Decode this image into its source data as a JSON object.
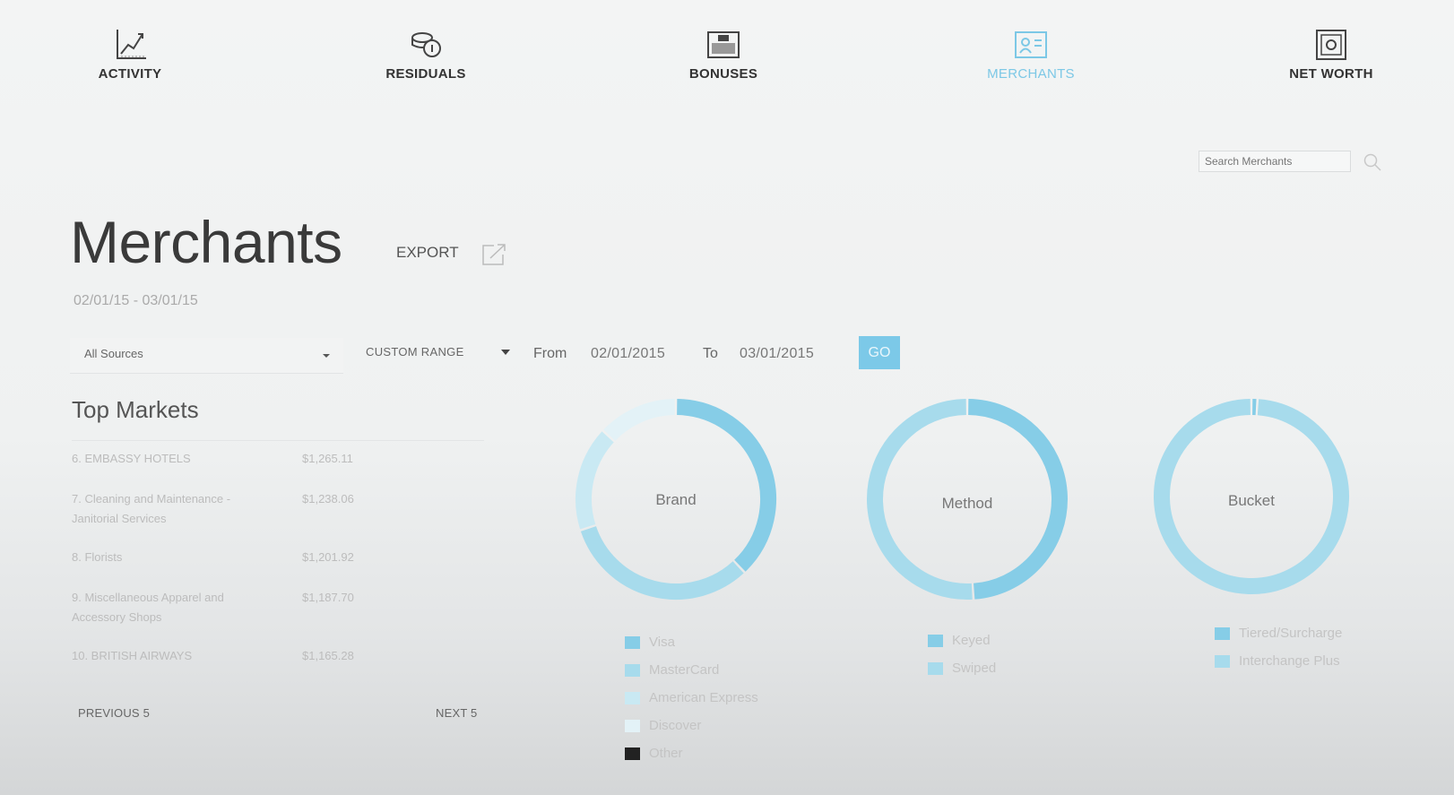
{
  "nav": [
    {
      "label": "ACTIVITY",
      "icon": "activity-chart-icon"
    },
    {
      "label": "RESIDUALS",
      "icon": "coins-icon"
    },
    {
      "label": "BONUSES",
      "icon": "bonus-cash-icon"
    },
    {
      "label": "MERCHANTS",
      "icon": "merchant-id-card-icon"
    },
    {
      "label": "NET WORTH",
      "icon": "safe-icon"
    }
  ],
  "active_nav": "MERCHANTS",
  "colors": {
    "accent": "#7cc9e8",
    "active_nav": "#7cc8e6",
    "text": "#333333"
  },
  "search": {
    "placeholder": "Search Merchants",
    "icon": "search-icon"
  },
  "page": {
    "title": "Merchants",
    "export_label": "EXPORT",
    "export_icon": "export-icon",
    "date_range": "02/01/15 - 03/01/15"
  },
  "filters": {
    "source": "All Sources",
    "range": "CUSTOM RANGE",
    "from_label": "From",
    "from_value": "02/01/2015",
    "to_label": "To",
    "to_value": "03/01/2015",
    "go_label": "GO"
  },
  "top_markets": {
    "title": "Top Markets",
    "rows": [
      {
        "name": "6. EMBASSY HOTELS",
        "value": "$1,265.11"
      },
      {
        "name": "7. Cleaning and Maintenance - Janitorial Services",
        "value": "$1,238.06"
      },
      {
        "name": "8. Florists",
        "value": "$1,201.92"
      },
      {
        "name": "9. Miscellaneous Apparel and Accessory Shops",
        "value": "$1,187.70"
      },
      {
        "name": "10. BRITISH AIRWAYS",
        "value": "$1,165.28"
      }
    ],
    "previous_label": "PREVIOUS 5",
    "next_label": "NEXT 5"
  },
  "chart_data": [
    {
      "type": "pie",
      "title": "Brand",
      "categories": [
        "Visa",
        "MasterCard",
        "American Express",
        "Discover",
        "Other"
      ],
      "values": [
        38,
        32,
        17,
        13,
        0
      ],
      "colors": [
        "#86cde7",
        "#a7dbec",
        "#c9e9f3",
        "#e3f2f7",
        "#222222"
      ]
    },
    {
      "type": "pie",
      "title": "Method",
      "categories": [
        "Keyed",
        "Swiped"
      ],
      "values": [
        49,
        51
      ],
      "colors": [
        "#86cde7",
        "#a7dbec"
      ]
    },
    {
      "type": "pie",
      "title": "Bucket",
      "categories": [
        "Tiered/Surcharge",
        "Interchange Plus"
      ],
      "values": [
        1,
        99
      ],
      "colors": [
        "#86cde7",
        "#a7dbec"
      ]
    }
  ]
}
